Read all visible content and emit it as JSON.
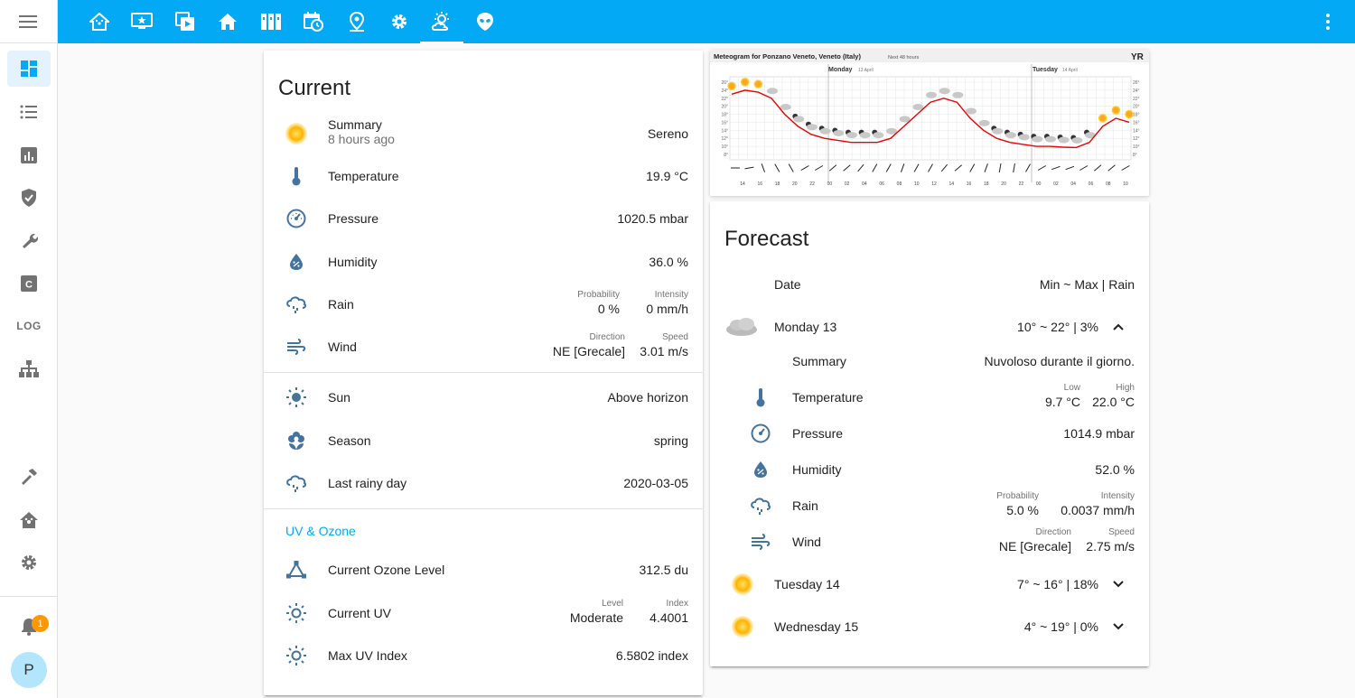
{
  "colors": {
    "accent": "#03a9f4",
    "icon": "#44739e",
    "sidebar_icon": "#727272"
  },
  "sidebar": {
    "menu_icon": "hamburger-menu-icon",
    "log_label": "LOG",
    "badge_count": "1",
    "avatar_initial": "P"
  },
  "current": {
    "title": "Current",
    "summary": {
      "label": "Summary",
      "ago": "8 hours ago",
      "value": "Sereno"
    },
    "temperature": {
      "label": "Temperature",
      "value": "19.9 °C"
    },
    "pressure": {
      "label": "Pressure",
      "value": "1020.5 mbar"
    },
    "humidity": {
      "label": "Humidity",
      "value": "36.0 %"
    },
    "rain": {
      "label": "Rain",
      "prob_key": "Probability",
      "prob_val": "0 %",
      "int_key": "Intensity",
      "int_val": "0 mm/h"
    },
    "wind": {
      "label": "Wind",
      "dir_key": "Direction",
      "dir_val": "NE [Grecale]",
      "speed_key": "Speed",
      "speed_val": "3.01 m/s"
    },
    "sun": {
      "label": "Sun",
      "value": "Above horizon"
    },
    "season": {
      "label": "Season",
      "value": "spring"
    },
    "last_rainy": {
      "label": "Last rainy day",
      "value": "2020-03-05"
    },
    "uv_section": "UV & Ozone",
    "ozone": {
      "label": "Current Ozone Level",
      "value": "312.5 du"
    },
    "uv": {
      "label": "Current UV",
      "level_key": "Level",
      "level_val": "Moderate",
      "index_key": "Index",
      "index_val": "4.4001"
    },
    "max_uv": {
      "label": "Max UV Index",
      "value": "6.5802 index"
    }
  },
  "meteogram": {
    "title": "Meteogram for Ponzano Veneto, Veneto (Italy)",
    "subtitle": "Next 48 hours",
    "logo": "YR",
    "day1": "Monday",
    "day1_date": "13 April",
    "day2": "Tuesday",
    "day2_date": "14 April",
    "y_ticks": [
      "26°",
      "24°",
      "22°",
      "20°",
      "18°",
      "16°",
      "14°",
      "12°",
      "10°",
      "8°"
    ],
    "hours": [
      "14",
      "16",
      "18",
      "20",
      "22",
      "00",
      "02",
      "04",
      "06",
      "08",
      "10",
      "12",
      "14",
      "16",
      "18",
      "20",
      "22",
      "00",
      "02",
      "04",
      "06",
      "08",
      "10"
    ],
    "temps": [
      23,
      24,
      23.5,
      22,
      18,
      15,
      13,
      12,
      11.5,
      11,
      11,
      11,
      12,
      15,
      18,
      21,
      22,
      21,
      17,
      14,
      12,
      11,
      10.5,
      10,
      10,
      9.8,
      9.7,
      11,
      15,
      17,
      16
    ]
  },
  "forecast": {
    "title": "Forecast",
    "header_date": "Date",
    "header_values": "Min ~ Max | Rain",
    "days": [
      {
        "name": "Monday 13",
        "values": "10° ~ 22° | 3%"
      },
      {
        "name": "Tuesday 14",
        "values": "7° ~ 16° | 18%"
      },
      {
        "name": "Wednesday 15",
        "values": "4° ~ 19° | 0%"
      }
    ],
    "detail": {
      "summary": {
        "label": "Summary",
        "value": "Nuvoloso durante il giorno."
      },
      "temperature": {
        "label": "Temperature",
        "low_key": "Low",
        "low_val": "9.7 °C",
        "high_key": "High",
        "high_val": "22.0 °C"
      },
      "pressure": {
        "label": "Pressure",
        "value": "1014.9 mbar"
      },
      "humidity": {
        "label": "Humidity",
        "value": "52.0 %"
      },
      "rain": {
        "label": "Rain",
        "prob_key": "Probability",
        "prob_val": "5.0 %",
        "int_key": "Intensity",
        "int_val": "0.0037 mm/h"
      },
      "wind": {
        "label": "Wind",
        "dir_key": "Direction",
        "dir_val": "NE [Grecale]",
        "speed_key": "Speed",
        "speed_val": "2.75 m/s"
      }
    }
  }
}
